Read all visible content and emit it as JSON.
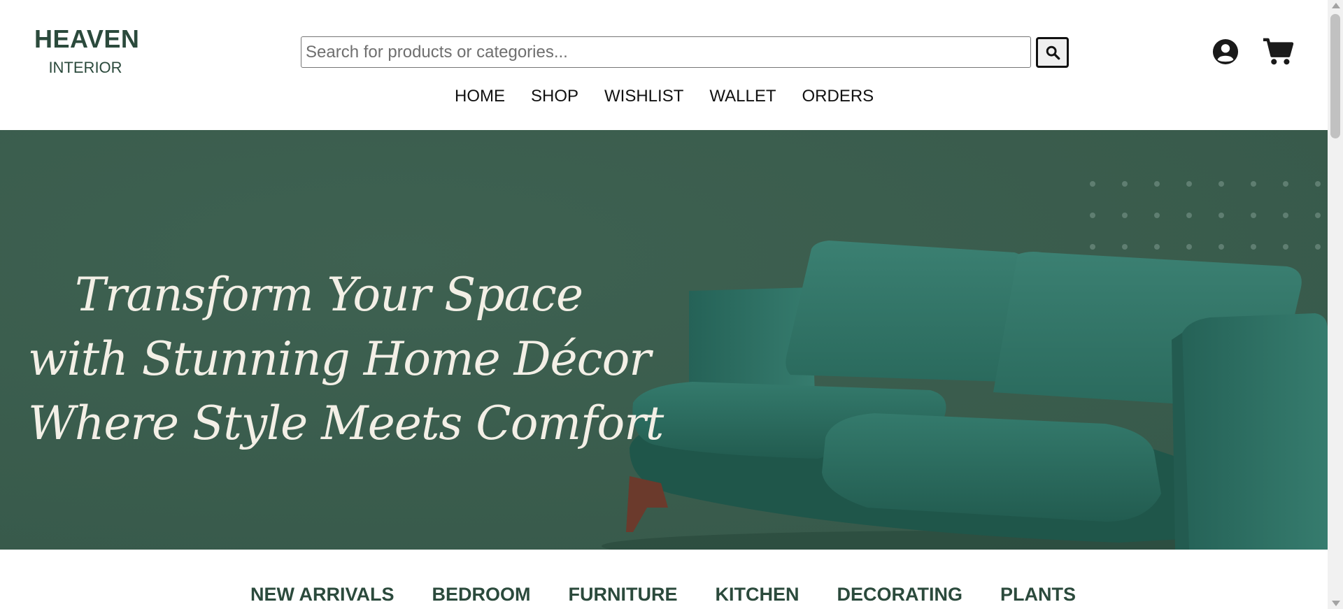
{
  "brand": {
    "title": "HEAVEN",
    "subtitle": "INTERIOR"
  },
  "search": {
    "placeholder": "Search for products or categories...",
    "value": "",
    "button_icon": "search-icon"
  },
  "nav": [
    "HOME",
    "SHOP",
    "WISHLIST",
    "WALLET",
    "ORDERS"
  ],
  "header_icons": {
    "account": "user-circle-icon",
    "cart": "shopping-cart-icon"
  },
  "hero": {
    "lines": [
      "Transform Your Space",
      "with Stunning Home Décor",
      "Where Style Meets Comfort"
    ],
    "image": "green velvet sofa"
  },
  "categories": [
    "NEW ARRIVALS",
    "BEDROOM",
    "FURNITURE",
    "KITCHEN",
    "DECORATING",
    "PLANTS"
  ],
  "colors": {
    "brand": "#2b4a3c",
    "hero_bg": "#3c5e4f",
    "sofa": "#2f6f62"
  }
}
